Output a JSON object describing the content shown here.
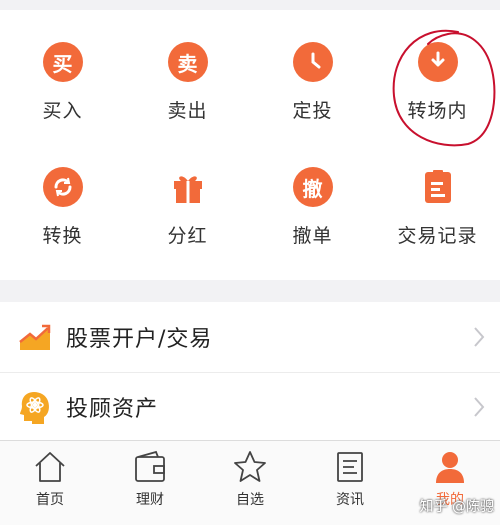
{
  "colors": {
    "accent": "#f26a3a",
    "annotation": "#c8102e"
  },
  "grid": {
    "items": [
      {
        "label": "买入",
        "glyph": "买",
        "icon": "buy-icon"
      },
      {
        "label": "卖出",
        "glyph": "卖",
        "icon": "sell-icon"
      },
      {
        "label": "定投",
        "glyph": "",
        "icon": "clock-icon"
      },
      {
        "label": "转场内",
        "glyph": "",
        "icon": "download-arrow-icon"
      },
      {
        "label": "转换",
        "glyph": "",
        "icon": "refresh-icon"
      },
      {
        "label": "分红",
        "glyph": "",
        "icon": "gift-icon"
      },
      {
        "label": "撤单",
        "glyph": "撤",
        "icon": "cancel-order-icon"
      },
      {
        "label": "交易记录",
        "glyph": "",
        "icon": "document-icon"
      }
    ]
  },
  "list": {
    "items": [
      {
        "label": "股票开户/交易",
        "icon": "trend-chart-icon"
      },
      {
        "label": "投顾资产",
        "icon": "advisor-brain-icon"
      }
    ]
  },
  "tabbar": {
    "items": [
      {
        "label": "首页",
        "icon": "home-icon"
      },
      {
        "label": "理财",
        "icon": "wallet-icon"
      },
      {
        "label": "自选",
        "icon": "star-icon"
      },
      {
        "label": "资讯",
        "icon": "news-icon"
      },
      {
        "label": "我的",
        "icon": "person-icon",
        "active": true
      }
    ]
  },
  "watermark": "知乎 @陈骢"
}
